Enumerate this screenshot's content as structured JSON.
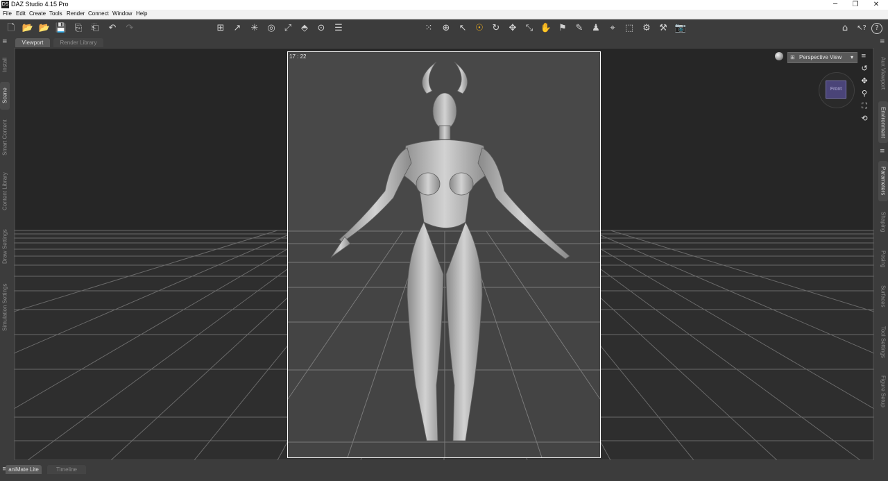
{
  "window": {
    "title": "DAZ Studio 4.15 Pro",
    "app_icon": "DS",
    "minimize": "─",
    "maximize": "❐",
    "close": "✕"
  },
  "menu": [
    "File",
    "Edit",
    "Create",
    "Tools",
    "Render",
    "Connect",
    "Window",
    "Help"
  ],
  "toolbar": {
    "left": [
      {
        "name": "new-scene-icon",
        "glyph": "🗋"
      },
      {
        "name": "open-icon",
        "glyph": "📂"
      },
      {
        "name": "merge-icon",
        "glyph": "📂"
      },
      {
        "name": "save-icon",
        "glyph": "💾"
      },
      {
        "name": "import-icon",
        "glyph": "⎘"
      },
      {
        "name": "export-icon",
        "glyph": "⎗"
      },
      {
        "name": "undo-icon",
        "glyph": "↶"
      },
      {
        "name": "redo-icon",
        "glyph": "↷"
      }
    ],
    "center": [
      {
        "name": "scene-creation-tool-icon",
        "glyph": "⊞"
      },
      {
        "name": "spot-render-tool-icon",
        "glyph": "↗"
      },
      {
        "name": "light-tool-icon",
        "glyph": "✳"
      },
      {
        "name": "geometry-tool-icon",
        "glyph": "◎"
      },
      {
        "name": "joint-editor-icon",
        "glyph": "⤢"
      },
      {
        "name": "geometry-editor-icon",
        "glyph": "⬘"
      },
      {
        "name": "node-alignment-icon",
        "glyph": "⊙"
      },
      {
        "name": "align-icon",
        "glyph": "☰"
      }
    ],
    "tools": [
      {
        "name": "region-navigator-icon",
        "glyph": "⁙"
      },
      {
        "name": "universal-tool-icon",
        "glyph": "⊕"
      },
      {
        "name": "node-selection-icon",
        "glyph": "↖"
      },
      {
        "name": "active-pose-icon",
        "glyph": "☉",
        "selected": true
      },
      {
        "name": "rotate-tool-icon",
        "glyph": "↻"
      },
      {
        "name": "translate-tool-icon",
        "glyph": "✥"
      },
      {
        "name": "scale-tool-icon",
        "glyph": "⤡"
      },
      {
        "name": "pose-tool-icon",
        "glyph": "✋"
      },
      {
        "name": "surface-selection-icon",
        "glyph": "⚑"
      },
      {
        "name": "surface-paint-icon",
        "glyph": "✎"
      },
      {
        "name": "figure-setup-icon",
        "glyph": "♟"
      },
      {
        "name": "camera-tool-icon",
        "glyph": "⌖"
      },
      {
        "name": "select-tool-icon",
        "glyph": "⬚"
      },
      {
        "name": "geometry-sculpt-icon",
        "glyph": "⚙"
      },
      {
        "name": "render-settings-icon",
        "glyph": "⚒"
      },
      {
        "name": "render-icon",
        "glyph": "📷"
      }
    ],
    "right": [
      {
        "name": "home-icon",
        "glyph": "⌂"
      },
      {
        "name": "whats-this-icon",
        "glyph": "↖?"
      },
      {
        "name": "help-icon",
        "glyph": "?"
      }
    ]
  },
  "tabs": {
    "viewport": "Viewport",
    "render_library": "Render Library"
  },
  "left_panes": [
    "Install",
    "Scene",
    "Smart Content",
    "Content Library",
    "Draw Settings",
    "Simulation Settings"
  ],
  "right_panes": [
    "Aux Viewport",
    "Environment",
    "Parameters",
    "Shaping",
    "Posing",
    "Surfaces",
    "Tool Settings",
    "Figure Setup"
  ],
  "viewport": {
    "frame_rate": "17 : 22",
    "view": "Perspective View",
    "view_cube_label": "Front",
    "controls": [
      {
        "name": "orbit-camera-icon",
        "glyph": "↺"
      },
      {
        "name": "pan-camera-icon",
        "glyph": "✥"
      },
      {
        "name": "zoom-camera-icon",
        "glyph": "⚲"
      },
      {
        "name": "frame-icon",
        "glyph": "⛶"
      },
      {
        "name": "reset-camera-icon",
        "glyph": "⟲"
      }
    ]
  },
  "bottom_tabs": {
    "animate": "aniMate Lite",
    "timeline": "Timeline"
  },
  "pane_menu_icon": "≡"
}
